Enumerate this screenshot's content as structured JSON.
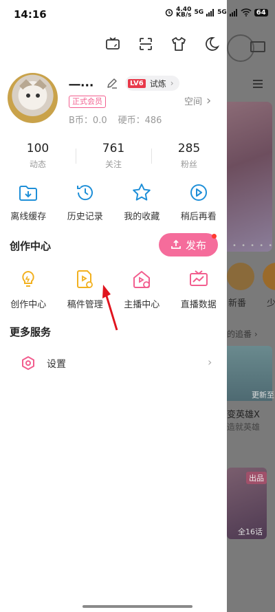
{
  "status_bar": {
    "time": "14:16",
    "speed": "4.40",
    "speed_unit": "KB/s",
    "signal1": "5G",
    "signal2": "5G",
    "battery": "64"
  },
  "top_icons": [
    "tv-icon",
    "scan-icon",
    "tshirt-icon",
    "moon-icon"
  ],
  "profile": {
    "username": "一···",
    "level_badge": "LV6",
    "level_text": "试炼",
    "level_chevron": "›",
    "vip_label": "正式会员",
    "space_label": "空间",
    "space_chevron": "›",
    "bcoin": "B币：0.0",
    "coin": "硬币：486"
  },
  "stats": [
    {
      "num": "100",
      "label": "动态"
    },
    {
      "num": "761",
      "label": "关注"
    },
    {
      "num": "285",
      "label": "粉丝"
    }
  ],
  "quick_actions": [
    {
      "label": "离线缓存",
      "icon": "download-folder-icon"
    },
    {
      "label": "历史记录",
      "icon": "history-clock-icon"
    },
    {
      "label": "我的收藏",
      "icon": "star-icon"
    },
    {
      "label": "稍后再看",
      "icon": "watch-later-icon"
    }
  ],
  "creation": {
    "title": "创作中心",
    "publish_label": "发布",
    "items": [
      {
        "label": "创作中心",
        "icon": "lightbulb-icon"
      },
      {
        "label": "稿件管理",
        "icon": "manuscript-icon"
      },
      {
        "label": "主播中心",
        "icon": "streamer-home-icon"
      },
      {
        "label": "直播数据",
        "icon": "live-data-icon"
      }
    ]
  },
  "more_services": {
    "title": "更多服务",
    "settings_label": "设置",
    "settings_chevron": "›"
  },
  "background": {
    "tab1": "新番",
    "tab2": "少",
    "follow_text": "的追番 ›",
    "card1_caption": "更新至",
    "title": "变英雄X",
    "subtitle": "造就英雄",
    "badge": "出品",
    "episodes": "全16话",
    "dots": "• • • • •"
  },
  "colors": {
    "accent_pink": "#f56c9b",
    "blue_icon": "#1e8fd8",
    "yellow_icon": "#f2b01e",
    "pink_icon": "#f25d8e"
  }
}
